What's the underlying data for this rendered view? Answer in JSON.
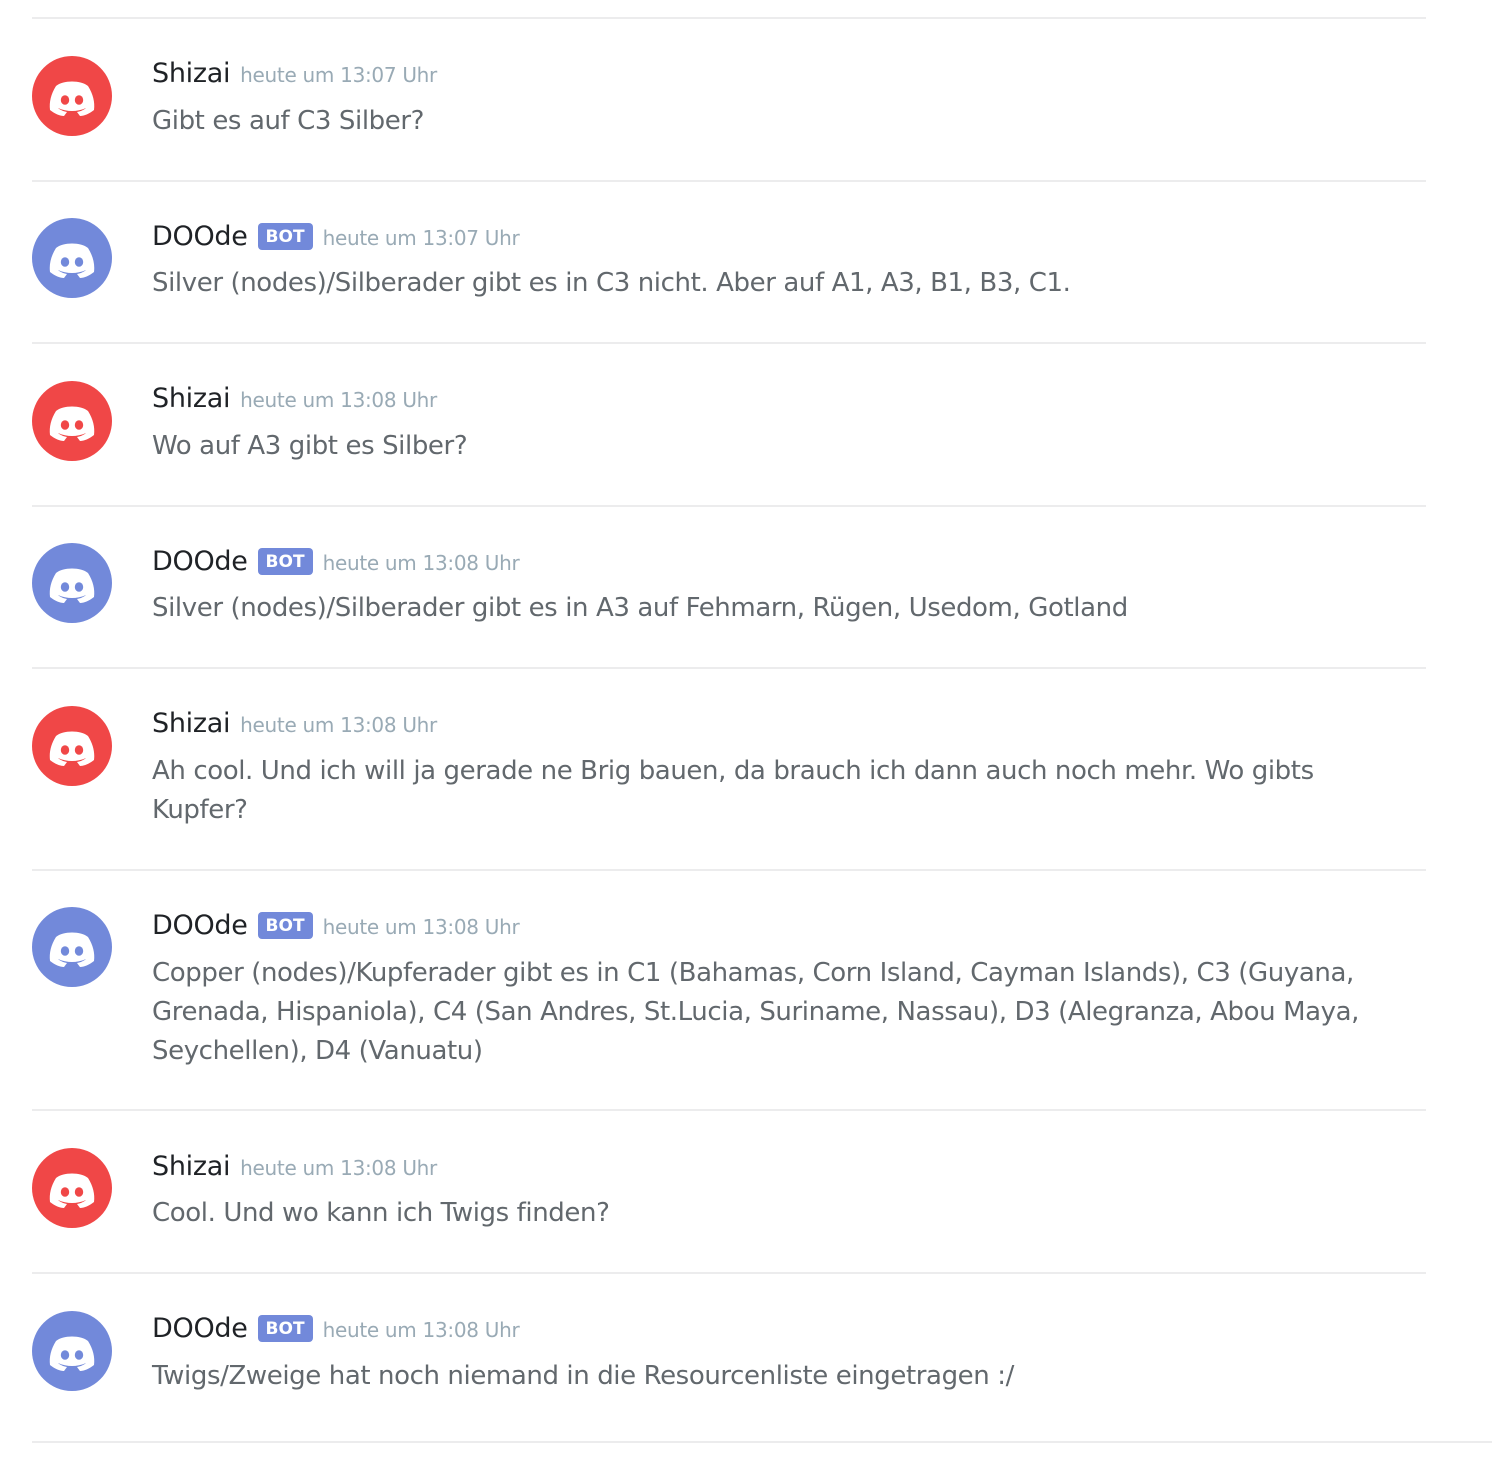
{
  "messages": [
    {
      "author": "Shizai",
      "is_bot": false,
      "avatar_color": "#f04747",
      "timestamp": "heute um 13:07 Uhr",
      "content": "Gibt es auf C3 Silber?"
    },
    {
      "author": "DOOde",
      "is_bot": true,
      "bot_tag": "BOT",
      "avatar_color": "#7289da",
      "timestamp": "heute um 13:07 Uhr",
      "content": "Silver (nodes)/Silberader gibt es in C3 nicht. Aber auf A1, A3, B1, B3, C1."
    },
    {
      "author": "Shizai",
      "is_bot": false,
      "avatar_color": "#f04747",
      "timestamp": "heute um 13:08 Uhr",
      "content": "Wo auf A3 gibt es Silber?"
    },
    {
      "author": "DOOde",
      "is_bot": true,
      "bot_tag": "BOT",
      "avatar_color": "#7289da",
      "timestamp": "heute um 13:08 Uhr",
      "content": "Silver (nodes)/Silberader gibt es in A3 auf Fehmarn, Rügen, Usedom, Gotland"
    },
    {
      "author": "Shizai",
      "is_bot": false,
      "avatar_color": "#f04747",
      "timestamp": "heute um 13:08 Uhr",
      "content": "Ah cool. Und ich will ja gerade ne Brig bauen, da brauch ich dann auch noch mehr. Wo gibts Kupfer?"
    },
    {
      "author": "DOOde",
      "is_bot": true,
      "bot_tag": "BOT",
      "avatar_color": "#7289da",
      "timestamp": "heute um 13:08 Uhr",
      "content": "Copper (nodes)/Kupferader gibt es in C1 (Bahamas, Corn Island, Cayman Islands), C3 (Guyana, Grenada, Hispaniola), C4 (San Andres, St.Lucia, Suriname, Nassau), D3 (Alegranza, Abou Maya, Seychellen), D4 (Vanuatu)"
    },
    {
      "author": "Shizai",
      "is_bot": false,
      "avatar_color": "#f04747",
      "timestamp": "heute um 13:08 Uhr",
      "content": "Cool. Und wo kann ich Twigs finden?"
    },
    {
      "author": "DOOde",
      "is_bot": true,
      "bot_tag": "BOT",
      "avatar_color": "#7289da",
      "timestamp": "heute um 13:08 Uhr",
      "content": "Twigs/Zweige hat noch niemand in die Resourcenliste eingetragen :/"
    }
  ],
  "icons": {
    "avatar": "discord-logo-icon"
  }
}
